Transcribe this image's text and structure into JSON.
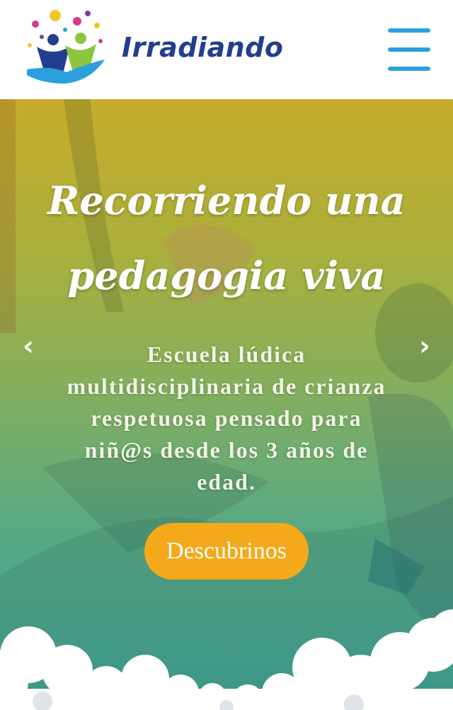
{
  "header": {
    "brand_name": "Irradiando"
  },
  "hero": {
    "title_line1": "Recorriendo una",
    "title_line2": "pedagogia viva",
    "subtitle_lines": [
      "Escuela lúdica",
      "multidisciplinaria de crianza",
      "respetuosa pensado para",
      "niñ@s desde los 3 años de",
      "edad."
    ],
    "prev_arrow": "‹",
    "next_arrow": "›",
    "cta_label": "Descubrinos"
  },
  "colors": {
    "brand_blue": "#233d8f",
    "menu_blue": "#2aa0dd",
    "cta_orange": "#f4a91a",
    "gradient_top": "#c8ac2a",
    "gradient_bottom": "#3aa59b"
  },
  "icons": {
    "menu": "hamburger-menu-icon",
    "prev": "chevron-left-icon",
    "next": "chevron-right-icon",
    "logo": "children-hand-logo-icon"
  }
}
